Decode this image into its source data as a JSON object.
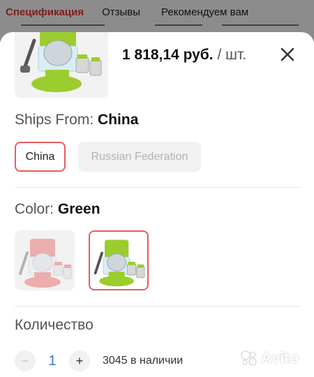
{
  "background_tabs": [
    {
      "label": "Спецификация"
    },
    {
      "label": "Отзывы"
    },
    {
      "label": "Рекомендуем вам"
    }
  ],
  "product": {
    "price": "1 818,14 руб.",
    "unit": "/ шт."
  },
  "ships_from": {
    "label": "Ships From:",
    "value": "China",
    "options": [
      {
        "label": "China",
        "selected": true
      },
      {
        "label": "Russian Federation",
        "selected": false
      }
    ]
  },
  "color": {
    "label": "Color:",
    "value": "Green",
    "options": [
      {
        "name": "red",
        "hex": "#e04848",
        "selected": false
      },
      {
        "name": "green",
        "hex": "#9ccd2f",
        "selected": true
      }
    ]
  },
  "quantity": {
    "label": "Количество",
    "value": "1",
    "minus": "−",
    "plus": "+",
    "stock": "3045 в наличии"
  },
  "watermark": {
    "text": "Avito"
  },
  "colors": {
    "accent": "#e45e5e",
    "qty": "#3b6fd6"
  }
}
